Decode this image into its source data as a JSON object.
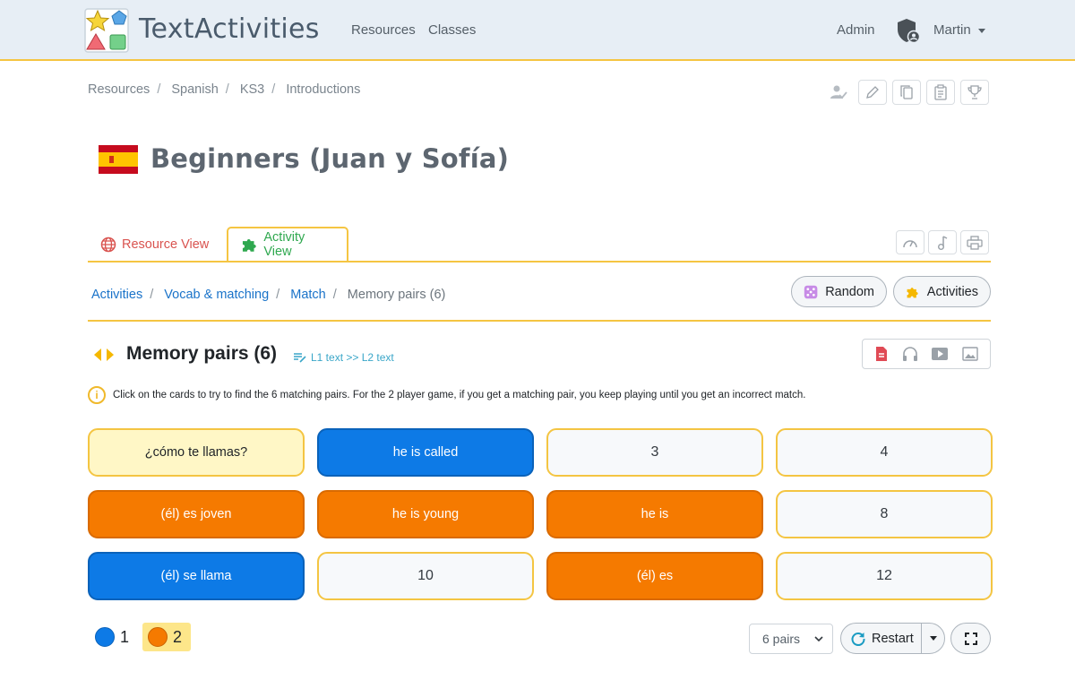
{
  "navbar": {
    "brand": "TextActivities",
    "links": [
      "Resources",
      "Classes"
    ],
    "admin": "Admin",
    "user": "Martin"
  },
  "breadcrumb": [
    "Resources",
    "Spanish",
    "KS3",
    "Introductions"
  ],
  "page": {
    "title": "Beginners (Juan y Sofía)"
  },
  "tabs": {
    "resource": "Resource View",
    "activity": "Activity View"
  },
  "activity_breadcrumb": [
    "Activities",
    "Vocab & matching",
    "Match",
    "Memory pairs (6)"
  ],
  "buttons": {
    "random": "Random",
    "activities": "Activities",
    "restart": "Restart"
  },
  "activity": {
    "title": "Memory pairs (6)",
    "subtype": "L1 text >> L2 text",
    "instructions": "Click on the cards to try to find the 6 matching pairs. For the 2 player game, if you get a matching pair, you keep playing until you get an incorrect match."
  },
  "cards": [
    {
      "text": "¿cómo te llamas?",
      "state": "pale"
    },
    {
      "text": "he is called",
      "state": "blue"
    },
    {
      "text": "3",
      "state": "hidden"
    },
    {
      "text": "4",
      "state": "hidden"
    },
    {
      "text": "(él) es joven",
      "state": "orange"
    },
    {
      "text": "he is young",
      "state": "orange"
    },
    {
      "text": "he is",
      "state": "orange"
    },
    {
      "text": "8",
      "state": "hidden"
    },
    {
      "text": "(él) se llama",
      "state": "blue"
    },
    {
      "text": "10",
      "state": "hidden"
    },
    {
      "text": "(él) es",
      "state": "orange"
    },
    {
      "text": "12",
      "state": "hidden"
    }
  ],
  "scores": {
    "player1": "1",
    "player2": "2"
  },
  "pairs_select": "6 pairs",
  "colors": {
    "accent": "#f5c542",
    "blue": "#0d7ae6",
    "orange": "#f57a00",
    "pale": "#fff7c6"
  }
}
